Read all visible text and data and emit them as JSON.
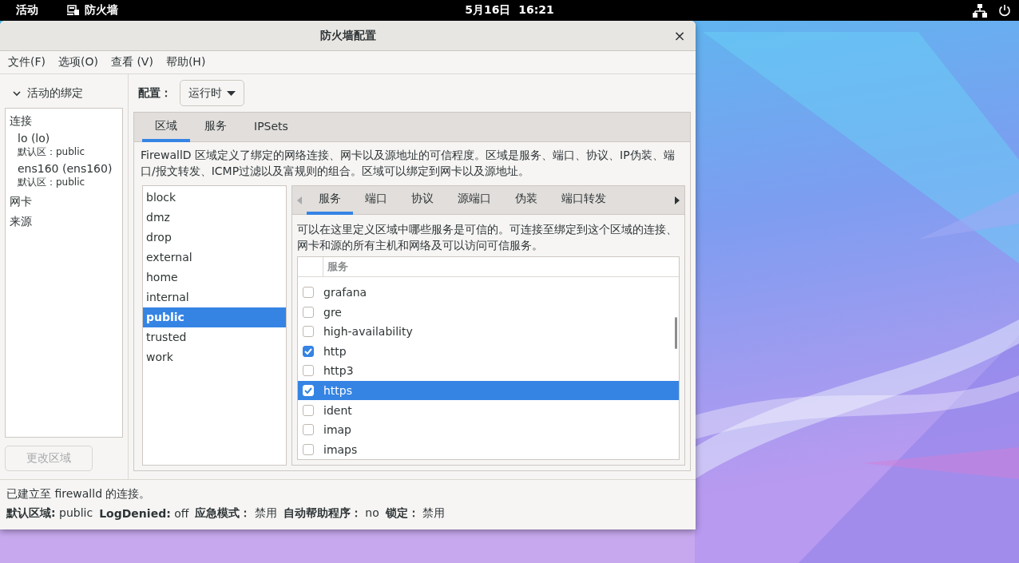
{
  "topbar": {
    "activities": "活动",
    "app_name": "防火墙",
    "clock": "5月16日  16:21"
  },
  "window": {
    "title": "防火墙配置",
    "close": "×"
  },
  "menu": [
    "文件(F)",
    "选项(O)",
    "查看 (V)",
    "帮助(H)"
  ],
  "bindings": {
    "header": "活动的绑定",
    "expanded": true,
    "sections": [
      {
        "label": "连接",
        "items": [
          {
            "name": "lo (lo)",
            "zone": "默认区：public"
          },
          {
            "name": "ens160 (ens160)",
            "zone": "默认区：public"
          }
        ]
      },
      {
        "label": "网卡"
      },
      {
        "label": "来源"
      }
    ],
    "button": {
      "label": "更改区域",
      "disabled": true
    }
  },
  "config": {
    "label": "配置：",
    "value": "运行时"
  },
  "tabs": [
    {
      "label": "区域",
      "selected": true
    },
    {
      "label": "服务",
      "selected": false
    },
    {
      "label": "IPSets",
      "selected": false
    }
  ],
  "zone_description": "FirewallD 区域定义了绑定的网络连接、网卡以及源地址的可信程度。区域是服务、端口、协议、IP伪装、端口/报文转发、ICMP过滤以及富规则的组合。区域可以绑定到网卡以及源地址。",
  "zones": [
    {
      "name": "block",
      "selected": false
    },
    {
      "name": "dmz",
      "selected": false
    },
    {
      "name": "drop",
      "selected": false
    },
    {
      "name": "external",
      "selected": false
    },
    {
      "name": "home",
      "selected": false
    },
    {
      "name": "internal",
      "selected": false
    },
    {
      "name": "public",
      "selected": true
    },
    {
      "name": "trusted",
      "selected": false
    },
    {
      "name": "work",
      "selected": false
    }
  ],
  "zone_tabs": [
    {
      "label": "服务",
      "selected": true
    },
    {
      "label": "端口",
      "selected": false
    },
    {
      "label": "协议",
      "selected": false
    },
    {
      "label": "源端口",
      "selected": false
    },
    {
      "label": "伪装",
      "selected": false
    },
    {
      "label": "端口转发",
      "selected": false
    }
  ],
  "services": {
    "description": "可以在这里定义区域中哪些服务是可信的。可连接至绑定到这个区域的连接、网卡和源的所有主机和网络及可以访问可信服务。",
    "column": "服务",
    "rows": [
      {
        "name": "grafana",
        "checked": false,
        "selected": false
      },
      {
        "name": "gre",
        "checked": false,
        "selected": false
      },
      {
        "name": "high-availability",
        "checked": false,
        "selected": false
      },
      {
        "name": "http",
        "checked": true,
        "selected": false
      },
      {
        "name": "http3",
        "checked": false,
        "selected": false
      },
      {
        "name": "https",
        "checked": true,
        "selected": true
      },
      {
        "name": "ident",
        "checked": false,
        "selected": false
      },
      {
        "name": "imap",
        "checked": false,
        "selected": false
      },
      {
        "name": "imaps",
        "checked": false,
        "selected": false
      }
    ]
  },
  "status": {
    "message": "已建立至 firewalld 的连接。",
    "fields": [
      {
        "label": "默认区域:",
        "value": "public"
      },
      {
        "label": "LogDenied:",
        "value": "off"
      },
      {
        "label": "应急模式：",
        "value": "禁用"
      },
      {
        "label": "自动帮助程序：",
        "value": "no"
      },
      {
        "label": "锁定：",
        "value": "禁用"
      }
    ]
  }
}
